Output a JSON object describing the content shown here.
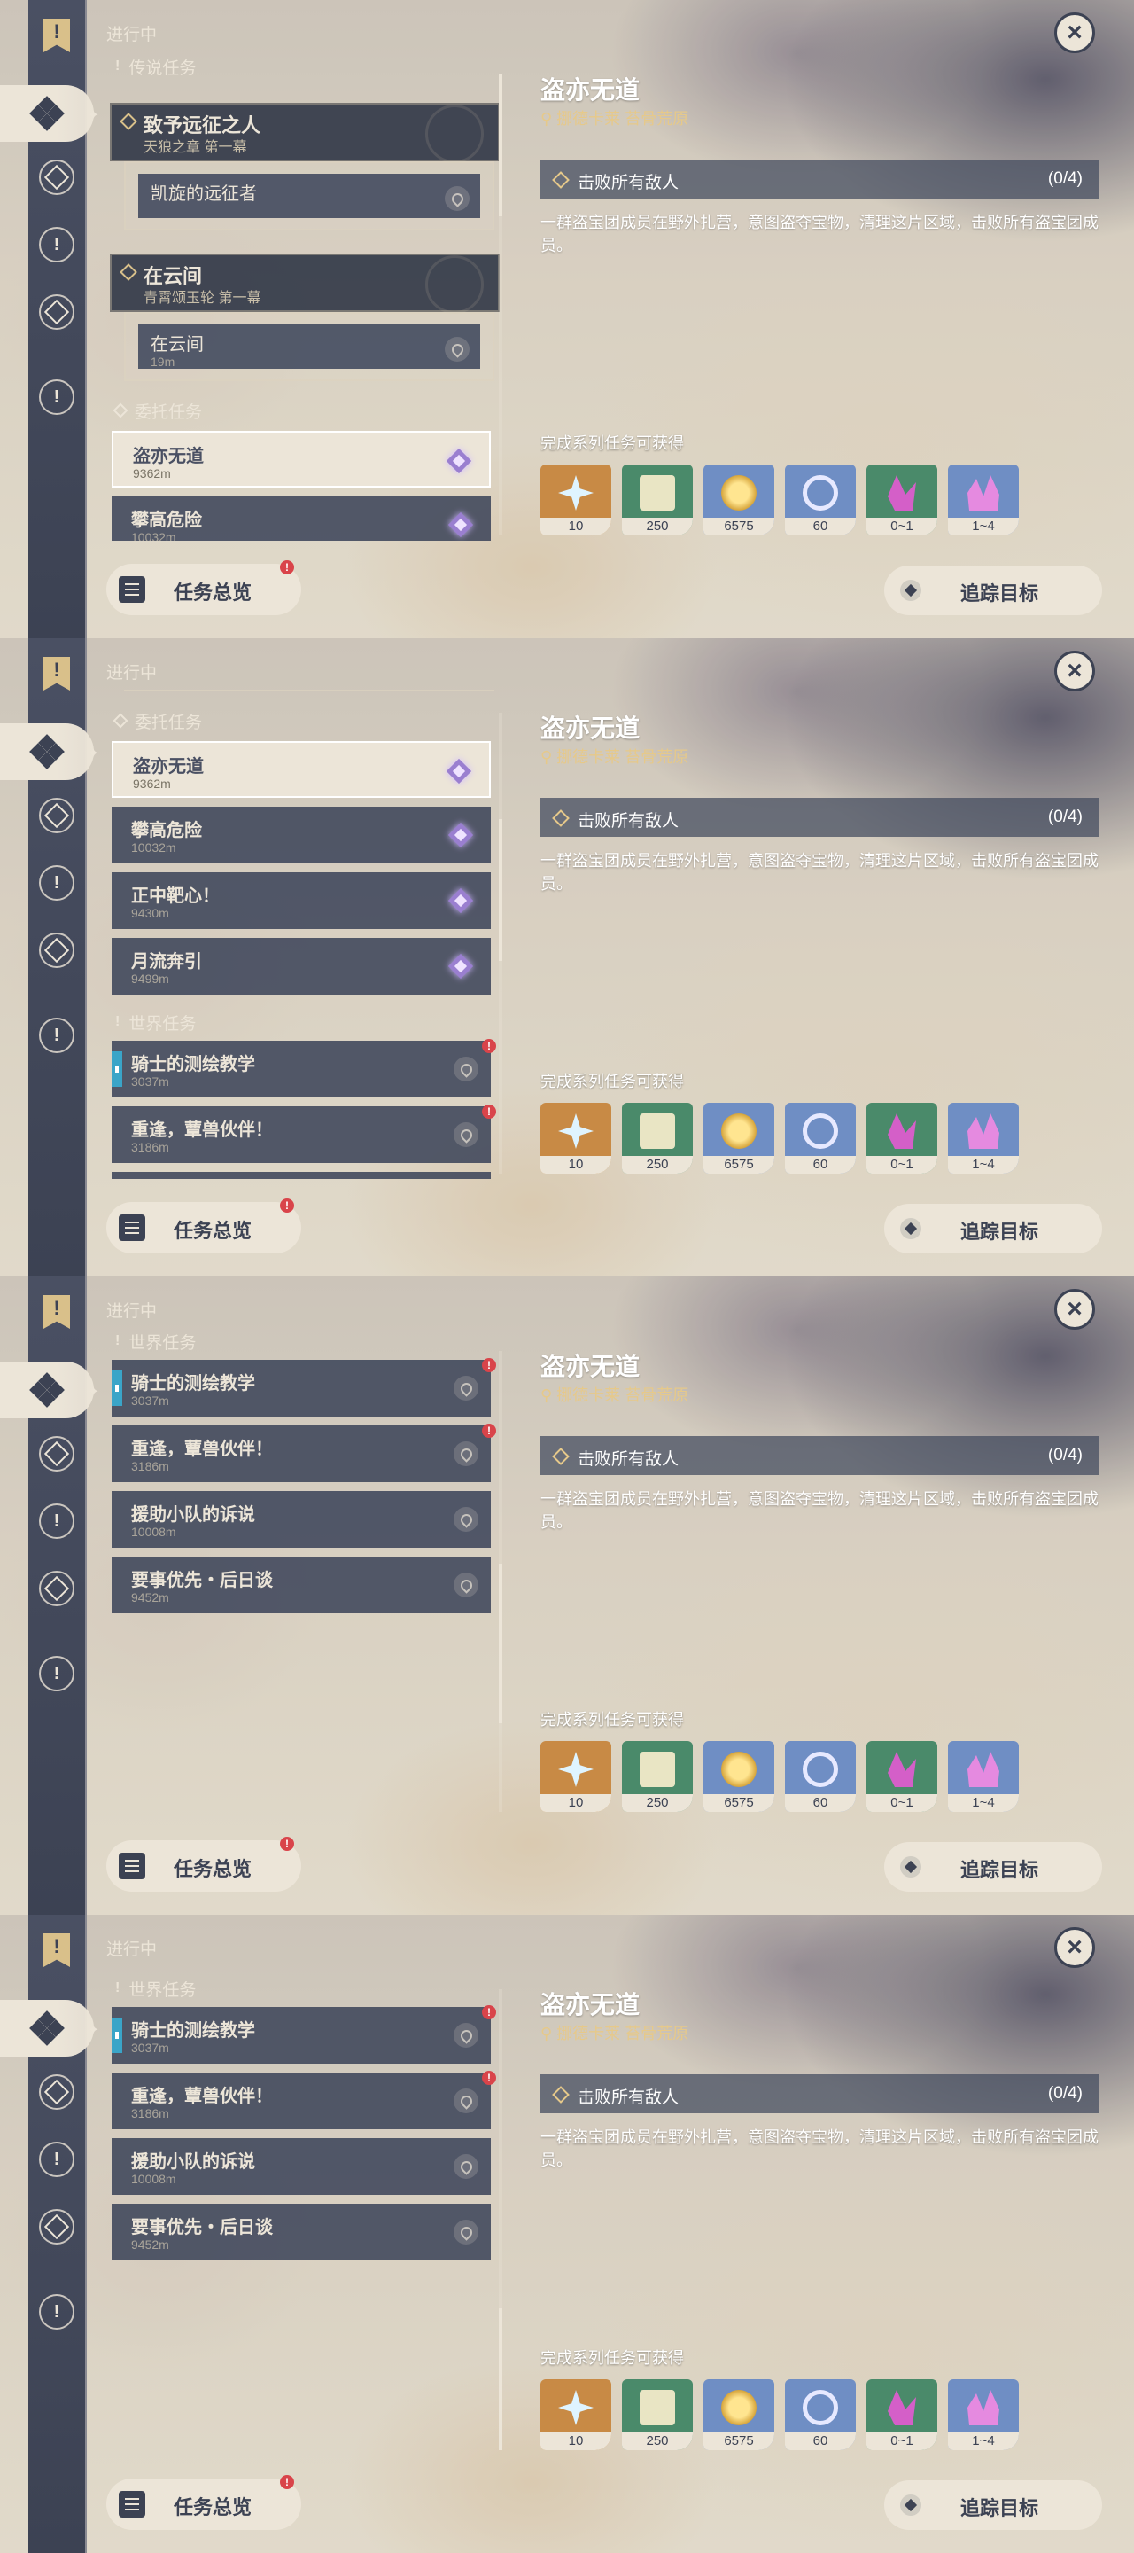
{
  "app": {
    "status_label": "进行中",
    "overview_label": "任务总览",
    "track_label": "追踪目标",
    "close_glyph": "×"
  },
  "detail": {
    "title": "盗亦无道",
    "location": "挪德卡莱 苔骨荒原",
    "objective": "击败所有敌人",
    "objective_count": "(0/4)",
    "description": "一群盗宝团成员在野外扎营，意图盗夺宝物，清理这片区域，击败所有盗宝团成员。",
    "rewards_label": "完成系列任务可获得",
    "rewards": [
      {
        "icon": "primogem-icon",
        "qty": "10"
      },
      {
        "icon": "adventure-exp-icon",
        "qty": "250"
      },
      {
        "icon": "mora-icon",
        "qty": "6575"
      },
      {
        "icon": "fate-icon",
        "qty": "60"
      },
      {
        "icon": "enhancement-ore-icon",
        "qty": "0~1"
      },
      {
        "icon": "fine-ore-icon",
        "qty": "1~4"
      }
    ]
  },
  "quests": {
    "legend_section": "传说任务",
    "legend_1": {
      "title": "致予远征之人",
      "chapter": "天狼之章 第一幕"
    },
    "legend_1_step": {
      "title": "凯旋的远征者"
    },
    "legend_2": {
      "title": "在云间",
      "chapter": "青霄颂玉轮 第一幕"
    },
    "legend_2_step": {
      "title": "在云间",
      "distance": "19m"
    },
    "commission_section": "委托任务",
    "commissions": [
      {
        "title": "盗亦无道",
        "distance": "9362m"
      },
      {
        "title": "攀高危险",
        "distance": "10032m"
      },
      {
        "title": "正中靶心！",
        "distance": "9430m"
      },
      {
        "title": "月流奔引",
        "distance": "9499m"
      }
    ],
    "world_section": "世界任务",
    "world": [
      {
        "title": "骑士的测绘教学",
        "distance": "3037m"
      },
      {
        "title": "重逢，蕈兽伙伴！",
        "distance": "3186m"
      },
      {
        "title": "援助小队的诉说",
        "distance": "10008m"
      },
      {
        "title": "要事优先・后日谈",
        "distance": "9452m"
      }
    ]
  }
}
